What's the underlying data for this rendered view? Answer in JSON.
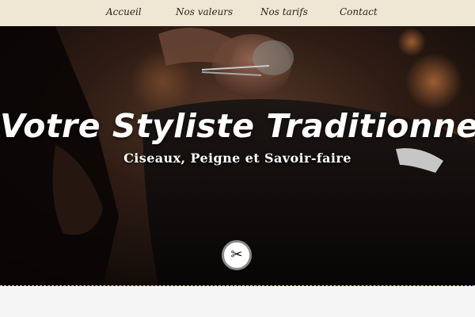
{
  "nav": {
    "items": [
      {
        "label": "Accueil"
      },
      {
        "label": "Nos valeurs"
      },
      {
        "label": "Nos tarifs"
      },
      {
        "label": "Contact"
      }
    ]
  },
  "hero": {
    "title": "Votre Styliste Traditionnel",
    "subtitle": "Ciseaux, Peigne et Savoir-faire",
    "scroll_icon": "scissors-icon",
    "scroll_glyph": "✂"
  },
  "colors": {
    "nav_background": "#efe6d4",
    "hero_text": "#ffffff",
    "content_background": "#f5f5f5"
  }
}
